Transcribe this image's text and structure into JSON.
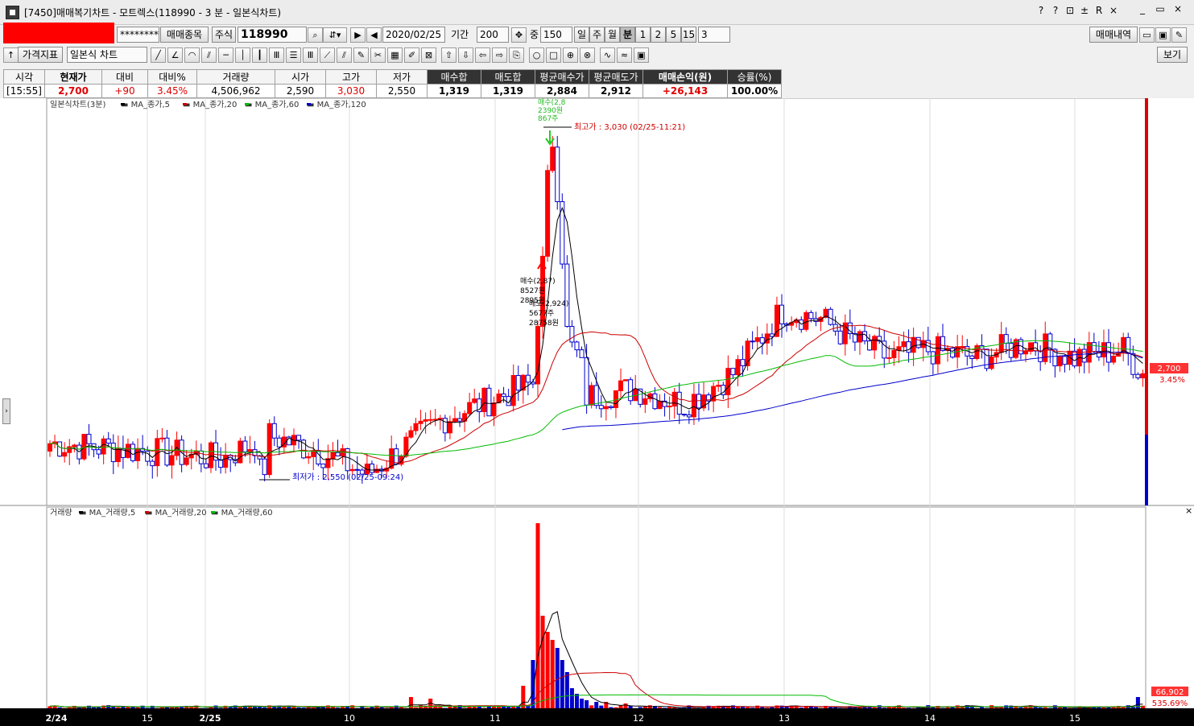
{
  "window": {
    "title": "[7450]매매복기차트 - 모트렉스(118990 - 3 분 - 일본식차트)",
    "tools": [
      "?",
      "?",
      "⊡",
      "±",
      "R",
      "×"
    ],
    "controls": [
      "_",
      "▭",
      "×"
    ]
  },
  "toolbar1": {
    "masked": "********",
    "trade_item": "매매종목",
    "market": "주식",
    "code": "118990",
    "date": "2020/02/25",
    "period_label": "기간",
    "period": "200",
    "mid_label": "중",
    "mid_value": "150",
    "timeframes": [
      "일",
      "주",
      "월",
      "분",
      "1",
      "2",
      "5",
      "15"
    ],
    "minute_select": "3",
    "trade_history": "매매내역"
  },
  "toolbar2": {
    "indicator_btn": "가격지표",
    "chart_type": "일본식 차트",
    "view_btn": "보기"
  },
  "info": {
    "headers": [
      "시각",
      "현재가",
      "대비",
      "대비%",
      "거래량",
      "시가",
      "고가",
      "저가",
      "매수합",
      "매도합",
      "평균매수가",
      "평균매도가",
      "매매손익(원)",
      "승률(%)"
    ],
    "values": [
      "[15:55]",
      "2,700",
      "+90",
      "3.45%",
      "4,506,962",
      "2,590",
      "3,030",
      "2,550",
      "1,319",
      "1,319",
      "2,884",
      "2,912",
      "+26,143",
      "100.00%"
    ]
  },
  "price_panel": {
    "legend": "일본식차트(3분)",
    "ma": [
      "MA_종가,5",
      "MA_종가,20",
      "MA_종가,60",
      "MA_종가,120"
    ],
    "high_label": "최고가 : 3,030 (02/25-11:21)",
    "low_label": "최저가 : 2,550 (02/25-09:24)",
    "current_price": "2,700",
    "current_pct": "3.45%",
    "marker_buy": [
      "매수(2,8",
      "2390원",
      "867주"
    ],
    "marker_mid": [
      "매수(2,87)",
      "8527원",
      "2895원"
    ],
    "marker_sell": [
      "매도(2,924)",
      "5677주",
      "28758원"
    ]
  },
  "volume_panel": {
    "legend": "거래량",
    "ma": [
      "MA_거래량,5",
      "MA_거래량,20",
      "MA_거래량,60"
    ],
    "last": "66,902",
    "pct": "535.69%"
  },
  "x_axis": {
    "labels": [
      {
        "t": "2/24",
        "bold": true
      },
      {
        "t": "15"
      },
      {
        "t": "2/25",
        "bold": true
      },
      {
        "t": "10"
      },
      {
        "t": "11"
      },
      {
        "t": "12"
      },
      {
        "t": "13"
      },
      {
        "t": "14"
      },
      {
        "t": "15"
      }
    ]
  },
  "colors": {
    "up": "#ff0000",
    "down": "#0000cc",
    "ma5": "#000000",
    "ma20": "#cc0000",
    "ma60": "#00bb00",
    "ma120": "#0000cc"
  }
}
